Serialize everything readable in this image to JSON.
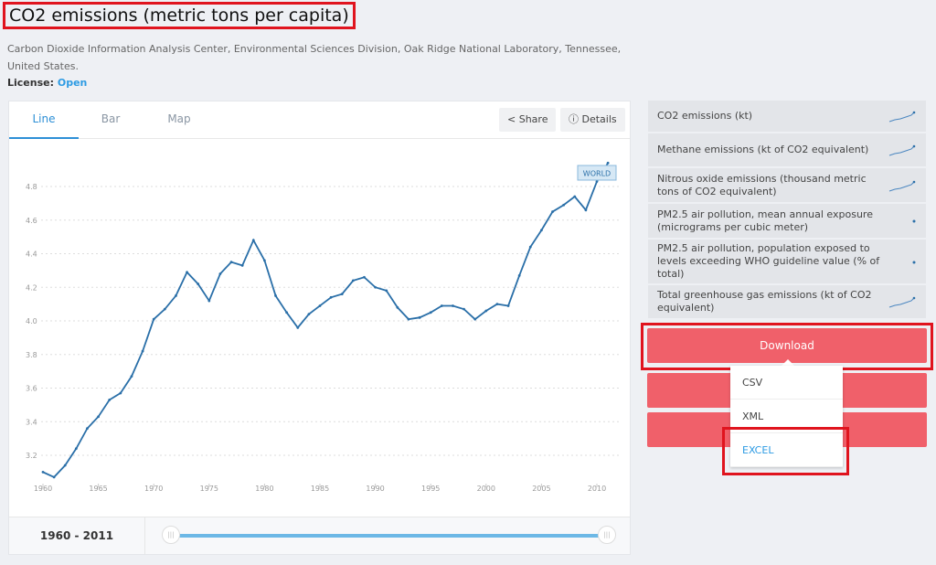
{
  "page": {
    "title": "CO2 emissions (metric tons per capita)",
    "source": "Carbon Dioxide Information Analysis Center, Environmental Sciences Division, Oak Ridge National Laboratory, Tennessee, United States.",
    "license_label": "License:",
    "license_value": "Open"
  },
  "tabs": [
    {
      "label": "Line",
      "active": true
    },
    {
      "label": "Bar"
    },
    {
      "label": "Map"
    }
  ],
  "toolbar": {
    "share": "Share",
    "details": "Details",
    "share_icon": "share-icon",
    "details_icon": "info-icon"
  },
  "range": {
    "label": "1960 - 2011",
    "start": 1960,
    "end": 2011
  },
  "related": [
    {
      "label": "CO2 emissions (kt)"
    },
    {
      "label": "Methane emissions (kt of CO2 equivalent)"
    },
    {
      "label": "Nitrous oxide emissions (thousand metric tons of CO2 equivalent)"
    },
    {
      "label": "PM2.5 air pollution, mean annual exposure (micrograms per cubic meter)"
    },
    {
      "label": "PM2.5 air pollution, population exposed to levels exceeding WHO guideline value (% of total)"
    },
    {
      "label": "Total greenhouse gas emissions (kt of CO2 equivalent)"
    }
  ],
  "download": {
    "label": "Download",
    "options": [
      "CSV",
      "XML",
      "EXCEL"
    ],
    "highlighted": "EXCEL"
  },
  "colors": {
    "accent": "#2d8fd6",
    "line": "#2a6fa8",
    "download": "#f0606a",
    "highlight": "#e0141e"
  },
  "chart_data": {
    "type": "line",
    "title": "",
    "xlabel": "",
    "ylabel": "",
    "xlim": [
      1960,
      2011
    ],
    "ylim": [
      3.05,
      4.97
    ],
    "grid": true,
    "yticks": [
      "3.2",
      "3.4",
      "3.6",
      "3.8",
      "4.0",
      "4.2",
      "4.4",
      "4.6",
      "4.8"
    ],
    "xticks": [
      "1960",
      "1965",
      "1970",
      "1975",
      "1980",
      "1985",
      "1990",
      "1995",
      "2000",
      "2005",
      "2010"
    ],
    "series": [
      {
        "name": "WORLD",
        "x": [
          1960,
          1961,
          1962,
          1963,
          1964,
          1965,
          1966,
          1967,
          1968,
          1969,
          1970,
          1971,
          1972,
          1973,
          1974,
          1975,
          1976,
          1977,
          1978,
          1979,
          1980,
          1981,
          1982,
          1983,
          1984,
          1985,
          1986,
          1987,
          1988,
          1989,
          1990,
          1991,
          1992,
          1993,
          1994,
          1995,
          1996,
          1997,
          1998,
          1999,
          2000,
          2001,
          2002,
          2003,
          2004,
          2005,
          2006,
          2007,
          2008,
          2009,
          2010,
          2011
        ],
        "values": [
          3.1,
          3.07,
          3.14,
          3.24,
          3.36,
          3.43,
          3.53,
          3.57,
          3.67,
          3.82,
          4.01,
          4.07,
          4.15,
          4.29,
          4.22,
          4.12,
          4.28,
          4.35,
          4.33,
          4.48,
          4.36,
          4.15,
          4.05,
          3.96,
          4.04,
          4.09,
          4.14,
          4.16,
          4.24,
          4.26,
          4.2,
          4.18,
          4.08,
          4.01,
          4.02,
          4.05,
          4.09,
          4.09,
          4.07,
          4.01,
          4.06,
          4.1,
          4.09,
          4.27,
          4.44,
          4.54,
          4.65,
          4.69,
          4.74,
          4.66,
          4.83,
          4.94
        ]
      }
    ]
  }
}
